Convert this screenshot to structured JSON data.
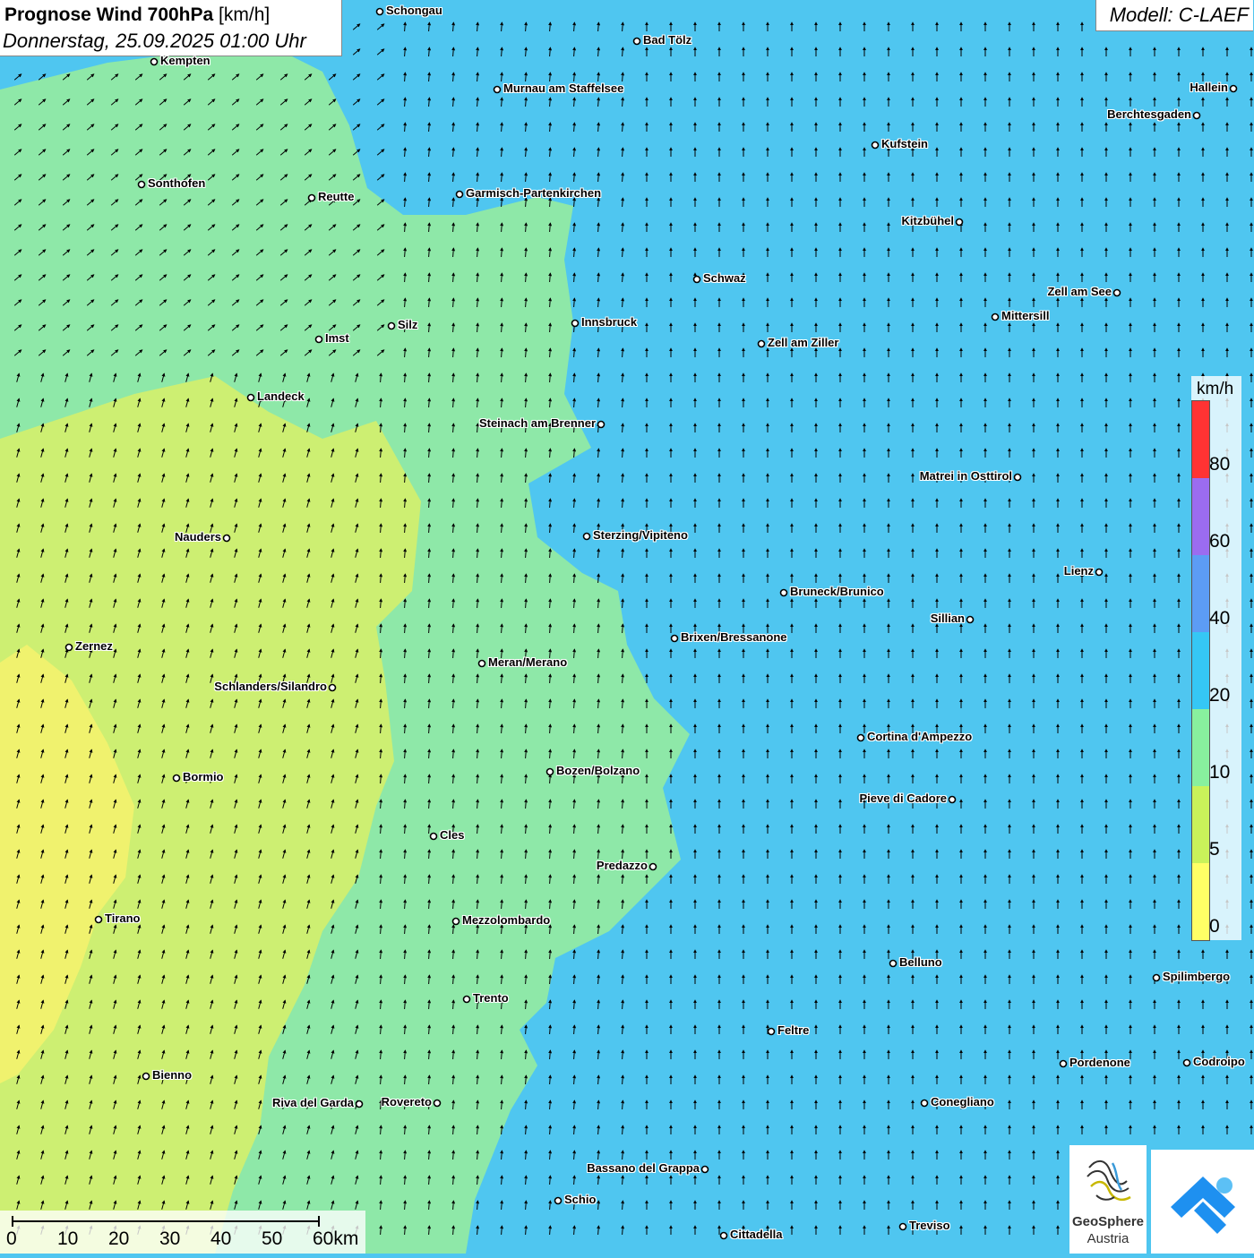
{
  "title": {
    "bold": "Prognose Wind 700hPa",
    "unit": " [km/h]",
    "date": "Donnerstag, 25.09.2025 01:00 Uhr"
  },
  "model": "Modell: C-LAEF",
  "legend": {
    "unit": "km/h",
    "labels": [
      "80",
      "60",
      "40",
      "20",
      "10",
      "5",
      "0"
    ],
    "colors": [
      "#ff3333",
      "#9b6cf0",
      "#5c9cf5",
      "#35c7f5",
      "#88f09e",
      "#c9f25a",
      "#ffff66"
    ]
  },
  "scale": {
    "labels": [
      "0",
      "10",
      "20",
      "30",
      "40",
      "50",
      "60km"
    ]
  },
  "cities": [
    "Schongau",
    "Bad Tölz",
    "Kempten",
    "Murnau am Staffelsee",
    "Hallein",
    "Berchtesgaden",
    "Kufstein",
    "Sonthofen",
    "Reutte",
    "Garmisch-Partenkirchen",
    "Kitzbühel",
    "Schwaz",
    "Zell am See",
    "Mittersill",
    "Innsbruck",
    "Imst",
    "Silz",
    "Zell am Ziller",
    "Landeck",
    "Steinach am Brenner",
    "Matrei in Osttirol",
    "Nauders",
    "Sterzing/Vipiteno",
    "Lienz",
    "Bruneck/Brunico",
    "Sillian",
    "Brixen/Bressanone",
    "Zernez",
    "Meran/Merano",
    "Schlanders/Silandro",
    "Cortina d'Ampezzo",
    "Bozen/Bolzano",
    "Bormio",
    "Pieve di Cadore",
    "Cles",
    "Predazzo",
    "Tirano",
    "Mezzolombardo",
    "Belluno",
    "Spilimbergo",
    "Trento",
    "Feltre",
    "Pordenone",
    "Codroipo",
    "Bienno",
    "Riva del Garda",
    "Rovereto",
    "Conegliano",
    "Bassano del Grappa",
    "Schio",
    "Treviso",
    "Cittadella"
  ],
  "logos": {
    "geosphere_name": "GeoSphere",
    "geosphere_sub": "Austria"
  }
}
